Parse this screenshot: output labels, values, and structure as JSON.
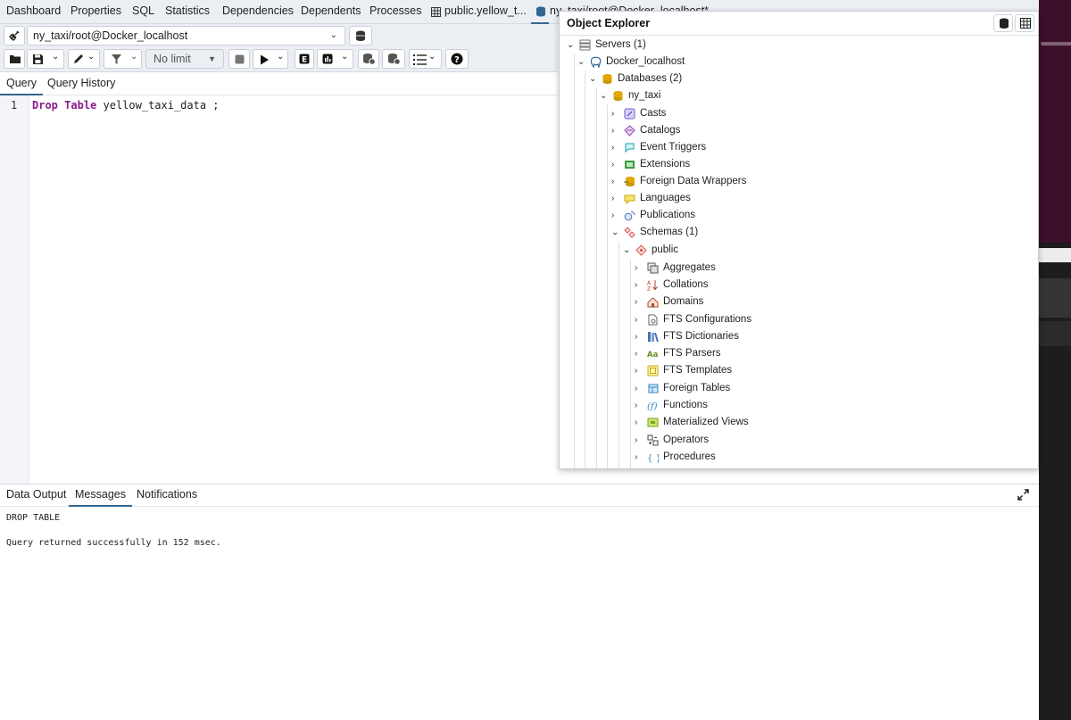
{
  "tabs": [
    "Dashboard",
    "Properties",
    "SQL",
    "Statistics",
    "Dependencies",
    "Dependents",
    "Processes",
    "public.yellow_t...",
    "ny_taxi/root@Docker_localhost*"
  ],
  "connection": {
    "value": "ny_taxi/root@Docker_localhost"
  },
  "toolbar": {
    "limit_value": "No limit"
  },
  "query_tabs": [
    "Query",
    "Query History"
  ],
  "editor": {
    "line_number": "1",
    "kw1": "Drop",
    "kw2": "Table",
    "rest": " yellow_taxi_data ;"
  },
  "result_tabs": [
    "Data Output",
    "Messages",
    "Notifications"
  ],
  "messages": {
    "line1": "DROP TABLE",
    "line2": "Query returned successfully in 152 msec."
  },
  "explorer": {
    "title": "Object Explorer",
    "tree": [
      {
        "label": "Servers (1)",
        "icon": "servers-icon"
      },
      {
        "label": "Docker_localhost",
        "icon": "postgres-elephant-icon"
      },
      {
        "label": "Databases (2)",
        "icon": "databases-icon"
      },
      {
        "label": "ny_taxi",
        "icon": "database-icon"
      },
      {
        "label": "Casts",
        "icon": "casts-icon"
      },
      {
        "label": "Catalogs",
        "icon": "catalogs-icon"
      },
      {
        "label": "Event Triggers",
        "icon": "event-triggers-icon"
      },
      {
        "label": "Extensions",
        "icon": "extensions-icon"
      },
      {
        "label": "Foreign Data Wrappers",
        "icon": "foreign-data-wrappers-icon"
      },
      {
        "label": "Languages",
        "icon": "languages-icon"
      },
      {
        "label": "Publications",
        "icon": "publications-icon"
      },
      {
        "label": "Schemas (1)",
        "icon": "schemas-icon"
      },
      {
        "label": "public",
        "icon": "schema-icon"
      },
      {
        "label": "Aggregates",
        "icon": "aggregates-icon"
      },
      {
        "label": "Collations",
        "icon": "collations-icon"
      },
      {
        "label": "Domains",
        "icon": "domains-icon"
      },
      {
        "label": "FTS Configurations",
        "icon": "fts-configurations-icon"
      },
      {
        "label": "FTS Dictionaries",
        "icon": "fts-dictionaries-icon"
      },
      {
        "label": "FTS Parsers",
        "icon": "fts-parsers-icon"
      },
      {
        "label": "FTS Templates",
        "icon": "fts-templates-icon"
      },
      {
        "label": "Foreign Tables",
        "icon": "foreign-tables-icon"
      },
      {
        "label": "Functions",
        "icon": "functions-icon"
      },
      {
        "label": "Materialized Views",
        "icon": "materialized-views-icon"
      },
      {
        "label": "Operators",
        "icon": "operators-icon"
      },
      {
        "label": "Procedures",
        "icon": "procedures-icon"
      }
    ]
  },
  "background": {
    "dashes": "========"
  },
  "colors": {
    "accent": "#326690",
    "keyword": "#8a1b8a",
    "terminal": "#3c0f2b"
  }
}
